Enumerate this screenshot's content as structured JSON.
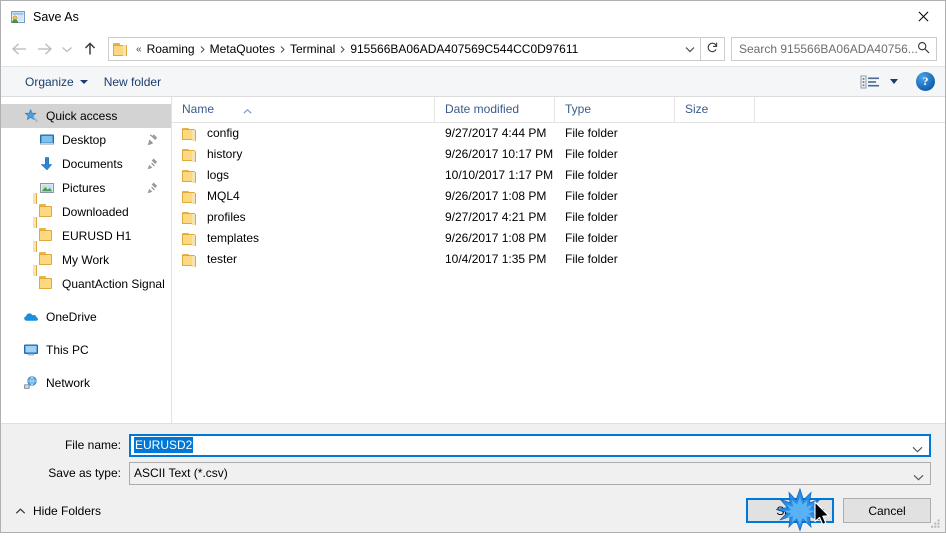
{
  "window": {
    "title": "Save As",
    "icon": "app-icon",
    "close_icon": "close-icon"
  },
  "nav": {
    "back_icon": "back-arrow-icon",
    "forward_icon": "forward-arrow-icon",
    "recent_icon": "chevron-down-icon",
    "up_icon": "up-arrow-icon",
    "refresh_icon": "refresh-icon",
    "address_folder_icon": "folder-icon",
    "breadcrumbs": [
      "Roaming",
      "MetaQuotes",
      "Terminal",
      "915566BA06ADA407569C544CC0D97611"
    ],
    "overflow_prefix": "«",
    "address_dropdown_icon": "chevron-down-icon"
  },
  "search": {
    "placeholder": "Search 915566BA06ADA40756...",
    "icon": "search-icon"
  },
  "toolbar": {
    "organize_label": "Organize",
    "new_folder_label": "New folder",
    "view_icon": "view-layout-icon",
    "view_caret_icon": "chevron-down-icon",
    "help_label": "?",
    "help_icon": "help-icon"
  },
  "sidebar": {
    "items": [
      {
        "label": "Quick access",
        "icon": "star-pin-icon",
        "selected": true,
        "indent": false,
        "pinned": false
      },
      {
        "label": "Desktop",
        "icon": "desktop-icon",
        "selected": false,
        "indent": true,
        "pinned": true
      },
      {
        "label": "Documents",
        "icon": "documents-icon",
        "selected": false,
        "indent": true,
        "pinned": true
      },
      {
        "label": "Pictures",
        "icon": "pictures-icon",
        "selected": false,
        "indent": true,
        "pinned": true
      },
      {
        "label": "Downloaded",
        "icon": "folder-icon",
        "selected": false,
        "indent": true,
        "pinned": false
      },
      {
        "label": "EURUSD H1",
        "icon": "folder-icon",
        "selected": false,
        "indent": true,
        "pinned": false
      },
      {
        "label": "My Work",
        "icon": "folder-icon",
        "selected": false,
        "indent": true,
        "pinned": false
      },
      {
        "label": "QuantAction Signal",
        "icon": "folder-icon",
        "selected": false,
        "indent": true,
        "pinned": false
      },
      {
        "label": "OneDrive",
        "icon": "onedrive-cloud-icon",
        "selected": false,
        "indent": false,
        "pinned": false,
        "gap_before": true
      },
      {
        "label": "This PC",
        "icon": "this-pc-icon",
        "selected": false,
        "indent": false,
        "pinned": false,
        "gap_before": true
      },
      {
        "label": "Network",
        "icon": "network-icon",
        "selected": false,
        "indent": false,
        "pinned": false,
        "gap_before": true
      }
    ]
  },
  "filelist": {
    "columns": [
      "Name",
      "Date modified",
      "Type",
      "Size"
    ],
    "sort_column": "Name",
    "sort_direction": "ascending",
    "rows": [
      {
        "name": "config",
        "date": "9/27/2017 4:44 PM",
        "type": "File folder",
        "size": ""
      },
      {
        "name": "history",
        "date": "9/26/2017 10:17 PM",
        "type": "File folder",
        "size": ""
      },
      {
        "name": "logs",
        "date": "10/10/2017 1:17 PM",
        "type": "File folder",
        "size": ""
      },
      {
        "name": "MQL4",
        "date": "9/26/2017 1:08 PM",
        "type": "File folder",
        "size": ""
      },
      {
        "name": "profiles",
        "date": "9/27/2017 4:21 PM",
        "type": "File folder",
        "size": ""
      },
      {
        "name": "templates",
        "date": "9/26/2017 1:08 PM",
        "type": "File folder",
        "size": ""
      },
      {
        "name": "tester",
        "date": "10/4/2017 1:35 PM",
        "type": "File folder",
        "size": ""
      }
    ]
  },
  "form": {
    "filename_label": "File name:",
    "filename_value": "EURUSD2",
    "filename_selected": true,
    "filetype_label": "Save as type:",
    "filetype_value": "ASCII Text (*.csv)",
    "dropdown_icon": "chevron-down-icon"
  },
  "footer": {
    "hide_folders_label": "Hide Folders",
    "hide_folders_icon": "chevron-up-icon",
    "save_label": "Save",
    "cancel_label": "Cancel",
    "resize_grip_icon": "resize-grip-icon",
    "click_effect": "click-starburst",
    "cursor": "mouse-pointer-cursor"
  },
  "colors": {
    "accent": "#0078d7",
    "folder_yellow": "#fcd881",
    "header_text": "#3a5b8c",
    "toolbar_text": "#1b3d6d",
    "selection": "#d3d3d3"
  }
}
